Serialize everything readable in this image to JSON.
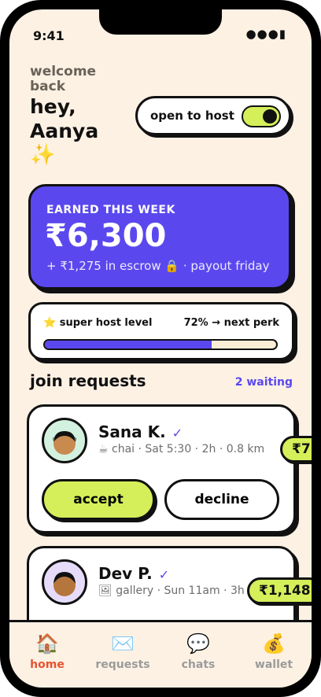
{
  "status_bar": {
    "time": "9:41",
    "icons": "●●●▮"
  },
  "header": {
    "welcome": "welcome back",
    "greeting": "hey, Aanya",
    "sparkle": "✨"
  },
  "host_toggle": {
    "label": "open to host",
    "on": true
  },
  "earnings": {
    "label": "EARNED THIS WEEK",
    "amount": "₹6,300",
    "sub": "+ ₹1,275 in escrow 🔒 · payout friday"
  },
  "level": {
    "label": "⭐ super host level",
    "progress_text": "72% → next perk",
    "progress": 0.72
  },
  "requests_section": {
    "title": "join requests",
    "count": "2 waiting"
  },
  "requests": [
    {
      "name": "Sana K.",
      "verified": "✓",
      "meta": "☕ chai · Sat 5:30 · 2h · 0.8 km",
      "price": "₹7",
      "accept": "accept",
      "decline": "decline"
    },
    {
      "name": "Dev P.",
      "verified": "✓",
      "meta": "🖼 gallery · Sun 11am · 3h",
      "price": "₹1,148"
    }
  ],
  "nav": [
    {
      "label": "home",
      "icon": "🏠",
      "active": true
    },
    {
      "label": "requests",
      "icon": "✉️"
    },
    {
      "label": "chats",
      "icon": "💬"
    },
    {
      "label": "wallet",
      "icon": "💰"
    }
  ],
  "colors": {
    "background": "#fdf1e4",
    "accent_purple": "#5a48ee",
    "accent_lime": "#d5ef5a",
    "active_nav": "#e5532e"
  }
}
